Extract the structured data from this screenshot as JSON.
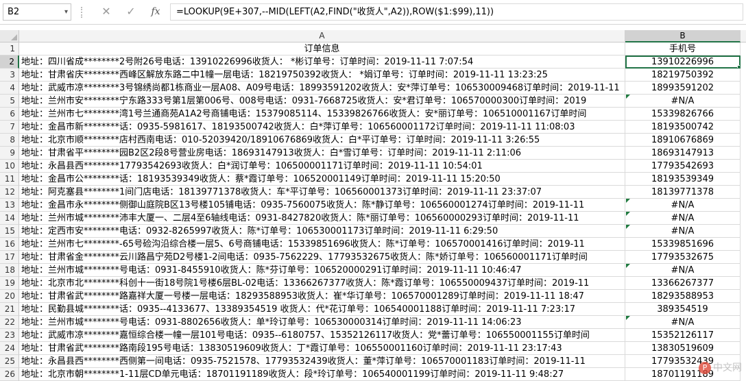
{
  "formula_bar": {
    "name_box": "B2",
    "cancel_icon": "cancel-icon",
    "enter_icon": "enter-icon",
    "fx_label": "fx",
    "formula": "=LOOKUP(9E+307,--MID(LEFT(A2,FIND(\"收货人\",A2)),ROW($1:$99),11))"
  },
  "columns": [
    "A",
    "B"
  ],
  "rows": [
    {
      "n": "1",
      "a": "订单信息",
      "b": "手机号"
    },
    {
      "n": "2",
      "a": "地址：四川省成********2号附26号电话：13910226996收货人：  *彬订单号：订单时间：2019-11-11 7:07:54",
      "b": "13910226996"
    },
    {
      "n": "3",
      "a": "地址：甘肃省庆********西峰区解放东路二中1幢一层电话：18219750392收货人：  *娟订单号：订单时间：2019-11-11 13:23:25",
      "b": "18219750392"
    },
    {
      "n": "4",
      "a": "地址：武威市凉********3号锦绣尚都1栋商业一层A08、A09号电话：18993591202收货人：安*萍订单号：106530009468订单时间：2019-11-11",
      "b": "18993591202"
    },
    {
      "n": "5",
      "a": "地址：兰州市安********宁东路333号第1层第006号、008号电话：0931-7668725收货人：安*君订单号：106570000300订单时间：2019",
      "b": "#N/A"
    },
    {
      "n": "6",
      "a": "地址：兰州市七********湾1号兰通商苑A1A2号商铺电话：15379085114、15339826766收货人：安*丽订单号：106510001167订单时间",
      "b": "15339826766"
    },
    {
      "n": "7",
      "a": "地址：金昌市新********话：0935-5981617、18193500742收货人：白*萍订单号：106560001172订单时间：2019-11-11 11:08:03",
      "b": "18193500742"
    },
    {
      "n": "8",
      "a": "地址：北京市顺********店村西南电话：010-52039420/18910676869收货人：白*平订单号：订单时间：2019-11-11 3:26:55",
      "b": "18910676869"
    },
    {
      "n": "9",
      "a": "地址：甘肃省平********园B2区2段8号营业房电话：18693147913收货人：白*雪订单号：订单时间：2019-11-11 2:11:06",
      "b": "18693147913"
    },
    {
      "n": "10",
      "a": "地址：永昌县西********17793542693收货人：白*润订单号：106500001171订单时间：2019-11-11 10:54:01",
      "b": "17793542693"
    },
    {
      "n": "11",
      "a": "地址：金昌市公********话：18193539349收货人：蔡*霞订单号：106520001149订单时间：2019-11-11 15:20:50",
      "b": "18193539349"
    },
    {
      "n": "12",
      "a": "地址：阿克塞县********1间门店电话：18139771378收货人：车*平订单号：106560001373订单时间：2019-11-11 23:37:07",
      "b": "18139771378"
    },
    {
      "n": "13",
      "a": "地址：金昌市永********侧御山庭院B区13号楼105铺电话：0935-7560075收货人：陈*静订单号：106560001274订单时间：2019-11-11",
      "b": "#N/A"
    },
    {
      "n": "14",
      "a": "地址：兰州市城********沛丰大厦一、二层4至6轴线电话：0931-8427820收货人：陈*丽订单号：106560000293订单时间：2019-11-11",
      "b": "#N/A"
    },
    {
      "n": "15",
      "a": "地址：定西市安********电话：0932-8265997收货人：陈*订单号：106530001173订单时间：2019-11-11 6:29:50",
      "b": "#N/A"
    },
    {
      "n": "16",
      "a": "地址：兰州市七********-65号硷沟沿综合楼一层5、6号商铺电话：15339851696收货人：陈*订单号：106570001416订单时间：2019-11",
      "b": "15339851696"
    },
    {
      "n": "17",
      "a": "地址：甘肃省金********云川路昌宁苑D2号楼1-2间电话：0935-7562229、17793532675收货人：陈*娇订单号：106560001171订单时间",
      "b": "17793532675"
    },
    {
      "n": "18",
      "a": "地址：兰州市城********号电话：0931-8455910收货人：陈*芬订单号：106520000291订单时间：2019-11-11 10:46:47",
      "b": "#N/A"
    },
    {
      "n": "19",
      "a": "地址：北京市北********科创十一街18号院1号楼6层BL-02电话：13366267377收货人：陈*霞订单号：106550009437订单时间：2019-11",
      "b": "13366267377"
    },
    {
      "n": "20",
      "a": "地址：甘肃省武********路嘉祥大厦一号楼一层电话：18293588953收货人：崔*华订单号：106570001289订单时间：2019-11-11 18:47",
      "b": "18293588953"
    },
    {
      "n": "21",
      "a": "地址：民勤县城********话：0935--4133677、13389354519  收货人：代*花订单号：106540001188订单时间：2019-11-11 7:23:17",
      "b": "389354519"
    },
    {
      "n": "22",
      "a": "地址：兰州市城********号电话：0931-8802656收货人：单*玲订单号：106530000314订单时间：2019-11-11 14:06:23",
      "b": "#N/A"
    },
    {
      "n": "23",
      "a": "地址：武威市凉********嘉恒综合楼一幢一层101号电话：0935--6180757、15352126117收货人：党*蕾订单号：106550001155订单时间",
      "b": "15352126117"
    },
    {
      "n": "24",
      "a": "地址：甘肃省武********路南段195号电话：13830519609收货人：丁*霞订单号：106550001160订单时间：2019-11-11 23:17:43",
      "b": "13830519609"
    },
    {
      "n": "25",
      "a": "地址：永昌县西********西侧第一间电话：0935-7521578、17793532439收货人：董*萍订单号：106570001183订单时间：2019-11-11",
      "b": "17793532439"
    },
    {
      "n": "26",
      "a": "地址：北京市朝********1-11层CD单元电话：18701191189收货人：段*玲订单号：106540001199订单时间：2019-11-11 9:48:27",
      "b": "18701191189"
    }
  ],
  "error_marker_rows": [
    "5",
    "13",
    "14",
    "15",
    "18",
    "22"
  ],
  "selected_cell": "B2",
  "watermark": "中文网",
  "colors": {
    "accent": "#217346",
    "error_marker": "#1f7a3f"
  }
}
